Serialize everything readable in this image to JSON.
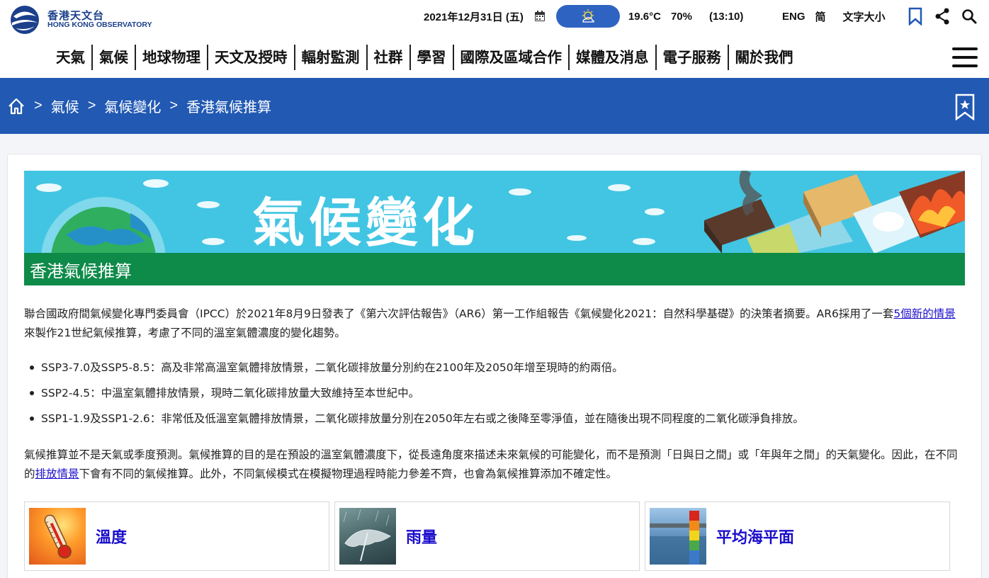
{
  "header": {
    "logo_zh": "香港天文台",
    "logo_en": "HONG KONG OBSERVATORY",
    "date": "2021年12月31日 (五)",
    "temperature": "19.6°C",
    "humidity": "70%",
    "time": "(13:10)",
    "lang_eng": "ENG",
    "lang_simplified": "简",
    "font_size": "文字大小"
  },
  "nav": {
    "items": [
      "天氣",
      "氣候",
      "地球物理",
      "天文及授時",
      "輻射監測",
      "社群",
      "學習",
      "國際及區域合作",
      "媒體及消息",
      "電子服務",
      "關於我們"
    ]
  },
  "breadcrumb": {
    "items": [
      "氣候",
      "氣候變化",
      "香港氣候推算"
    ],
    "separator": ">"
  },
  "banner": {
    "title": "氣候變化",
    "subtitle": "香港氣候推算"
  },
  "content": {
    "intro_before_link": "聯合國政府間氣候變化專門委員會（IPCC）於2021年8月9日發表了《第六次評估報告》（AR6）第一工作組報告《氣候變化2021：自然科學基礎》的決策者摘要。AR6採用了一套",
    "intro_link": "5個新的情景",
    "intro_after_link": "來製作21世紀氣候推算，考慮了不同的溫室氣體濃度的變化趨勢。",
    "bullets": [
      "SSP3-7.0及SSP5-8.5：高及非常高溫室氣體排放情景，二氧化碳排放量分別約在2100年及2050年增至現時的約兩倍。",
      "SSP2-4.5：中溫室氣體排放情景，現時二氧化碳排放量大致維持至本世紀中。",
      "SSP1-1.9及SSP1-2.6：非常低及低溫室氣體排放情景，二氧化碳排放量分別在2050年左右或之後降至零淨值，並在隨後出現不同程度的二氧化碳淨負排放。"
    ],
    "para2_before_link": "氣候推算並不是天氣或季度預測。氣候推算的目的是在預設的溫室氣體濃度下，從長遠角度來描述未來氣候的可能變化，而不是預測「日與日之間」或「年與年之間」的天氣變化。因此，在不同的",
    "para2_link": "排放情景",
    "para2_after_link": "下會有不同的氣候推算。此外，不同氣候模式在模擬物理過程時能力參差不齊，也會為氣候推算添加不確定性。"
  },
  "tiles": [
    {
      "label": "溫度",
      "icon": "thermometer-photo"
    },
    {
      "label": "雨量",
      "icon": "umbrella-photo"
    },
    {
      "label": "平均海平面",
      "icon": "sea-level-photo"
    }
  ],
  "colors": {
    "brand_blue": "#2159b3",
    "banner_green": "#0e8a49",
    "banner_sky": "#42c5e3",
    "link": "#1a0dcc"
  }
}
